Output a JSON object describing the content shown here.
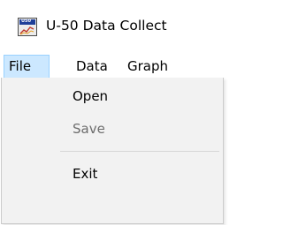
{
  "window": {
    "title": "U-50 Data Collect",
    "icon": "u50-app-icon",
    "icon_label": "U50"
  },
  "menubar": {
    "items": [
      {
        "label": "File",
        "active": true
      },
      {
        "label": "Data",
        "active": false
      },
      {
        "label": "Graph",
        "active": false
      }
    ]
  },
  "file_menu": {
    "items": [
      {
        "label": "Open",
        "enabled": true
      },
      {
        "label": "Save",
        "enabled": false
      },
      {
        "label": "Exit",
        "enabled": true
      }
    ]
  },
  "colors": {
    "menu_highlight": "#cce8ff",
    "menu_highlight_border": "#99d1ff",
    "dropdown_background": "#f2f2f2",
    "disabled_text": "#6d6d6d"
  }
}
